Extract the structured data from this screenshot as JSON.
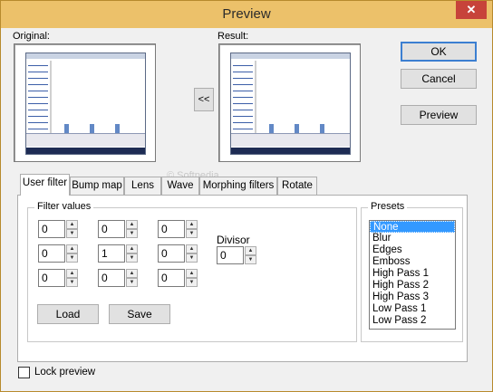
{
  "window": {
    "title": "Preview",
    "close_glyph": "✕"
  },
  "labels": {
    "original": "Original:",
    "result": "Result:"
  },
  "buttons": {
    "ok": "OK",
    "cancel": "Cancel",
    "preview": "Preview",
    "copy": "<<",
    "load": "Load",
    "save": "Save"
  },
  "tabs": [
    {
      "label": "User filter",
      "active": true
    },
    {
      "label": "Bump map"
    },
    {
      "label": "Lens"
    },
    {
      "label": "Wave"
    },
    {
      "label": "Morphing filters"
    },
    {
      "label": "Rotate"
    }
  ],
  "filter": {
    "legend": "Filter values",
    "values": [
      "0",
      "0",
      "0",
      "0",
      "1",
      "0",
      "0",
      "0",
      "0"
    ],
    "divisor_label": "Divisor",
    "divisor_value": "0"
  },
  "presets": {
    "legend": "Presets",
    "items": [
      "None",
      "Blur",
      "Edges",
      "Emboss",
      "High Pass 1",
      "High Pass 2",
      "High Pass 3",
      "Low Pass 1",
      "Low Pass 2"
    ],
    "selected": "None"
  },
  "lock_preview": {
    "label": "Lock preview",
    "checked": false
  },
  "watermark": "© Softpedia"
}
